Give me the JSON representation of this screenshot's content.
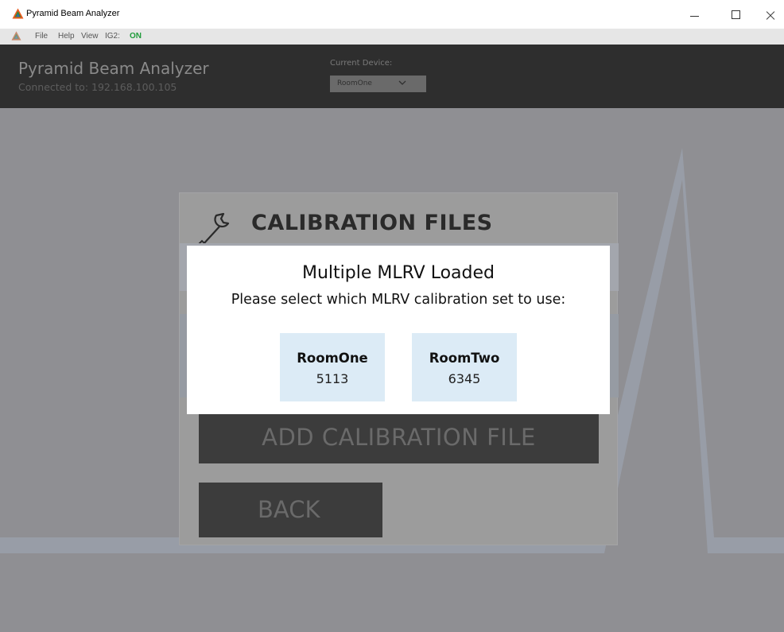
{
  "window": {
    "title": "Pyramid Beam Analyzer"
  },
  "menu": {
    "file": "File",
    "help": "Help",
    "view": "View",
    "ig2_label": "IG2:",
    "ig2_status": "ON"
  },
  "header": {
    "app_name": "Pyramid Beam Analyzer",
    "connection": "Connected to: 192.168.100.105",
    "device_label": "Current Device:",
    "device_value": "RoomOne"
  },
  "panel": {
    "title": "CALIBRATION FILES",
    "add_button": "ADD CALIBRATION FILE",
    "back_button": "BACK"
  },
  "dialog": {
    "title": "Multiple MLRV Loaded",
    "subtitle": "Please select which MLRV calibration set to use:",
    "options": [
      {
        "name": "RoomOne",
        "value": "5113"
      },
      {
        "name": "RoomTwo",
        "value": "6345"
      }
    ]
  },
  "colors": {
    "status_on": "#1f9b3a",
    "header_bg": "#2e2e2e",
    "choice_bg": "#dcebf6"
  }
}
